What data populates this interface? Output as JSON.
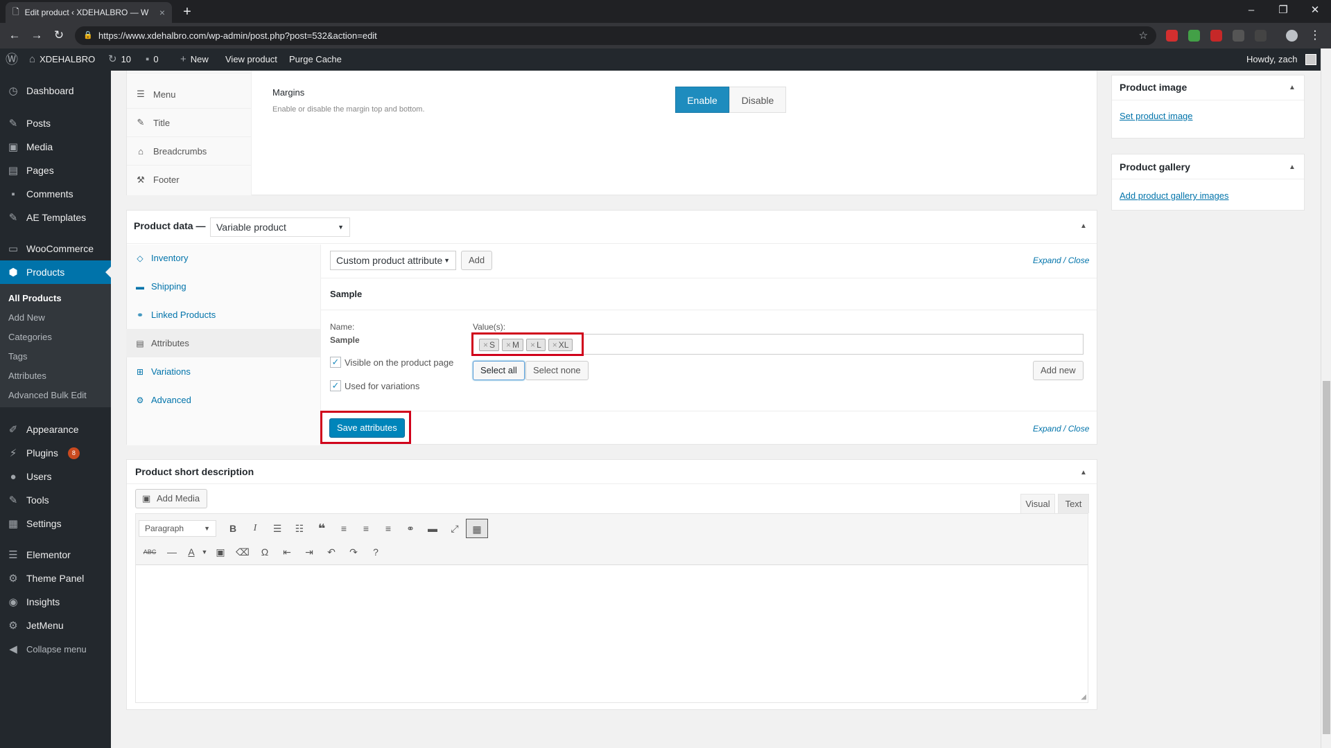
{
  "browser": {
    "tab_title": "Edit product ‹ XDEHALBRO — W",
    "url": "https://www.xdehalbro.com/wp-admin/post.php?post=532&action=edit"
  },
  "adminbar": {
    "site_name": "XDEHALBRO",
    "updates_count": "10",
    "comments_count": "0",
    "new_label": "New",
    "view_product": "View product",
    "purge_cache": "Purge Cache",
    "howdy": "Howdy, zach"
  },
  "sidebar": {
    "items": [
      {
        "label": "Dashboard",
        "icon": "dashboard-icon"
      },
      {
        "label": "Posts",
        "icon": "pin-icon"
      },
      {
        "label": "Media",
        "icon": "media-icon"
      },
      {
        "label": "Pages",
        "icon": "pages-icon"
      },
      {
        "label": "Comments",
        "icon": "comment-icon"
      },
      {
        "label": "AE Templates",
        "icon": "pin-icon"
      },
      {
        "label": "WooCommerce",
        "icon": "woo-icon"
      },
      {
        "label": "Products",
        "icon": "box-icon"
      },
      {
        "label": "Appearance",
        "icon": "brush-icon"
      },
      {
        "label": "Plugins",
        "icon": "plug-icon",
        "badge": "8"
      },
      {
        "label": "Users",
        "icon": "user-icon"
      },
      {
        "label": "Tools",
        "icon": "wrench-icon"
      },
      {
        "label": "Settings",
        "icon": "settings-icon"
      },
      {
        "label": "Elementor",
        "icon": "elementor-icon"
      },
      {
        "label": "Theme Panel",
        "icon": "gear-icon"
      },
      {
        "label": "Insights",
        "icon": "insights-icon"
      },
      {
        "label": "JetMenu",
        "icon": "gear-icon"
      },
      {
        "label": "Collapse menu",
        "icon": "collapse-icon"
      }
    ],
    "submenu": [
      "All Products",
      "Add New",
      "Categories",
      "Tags",
      "Attributes",
      "Advanced Bulk Edit"
    ]
  },
  "settings_box": {
    "tabs": [
      "Menu",
      "Title",
      "Breadcrumbs",
      "Footer"
    ],
    "margins_label": "Margins",
    "margins_desc": "Enable or disable the margin top and bottom.",
    "enable": "Enable",
    "disable": "Disable"
  },
  "product_data": {
    "title": "Product data —",
    "type": "Variable product",
    "tabs": [
      "Inventory",
      "Shipping",
      "Linked Products",
      "Attributes",
      "Variations",
      "Advanced"
    ],
    "attr_select": "Custom product attribute",
    "add_btn": "Add",
    "expand_close": "Expand / Close",
    "attr_title": "Sample",
    "name_label": "Name:",
    "name_value": "Sample",
    "values_label": "Value(s):",
    "values": [
      "S",
      "M",
      "L",
      "XL"
    ],
    "visible_label": "Visible on the product page",
    "variations_label": "Used for variations",
    "select_all": "Select all",
    "select_none": "Select none",
    "add_new": "Add new",
    "save_attributes": "Save attributes"
  },
  "short_desc": {
    "title": "Product short description",
    "add_media": "Add Media",
    "visual": "Visual",
    "text": "Text",
    "format": "Paragraph"
  },
  "right": {
    "image_title": "Product image",
    "set_image": "Set product image",
    "gallery_title": "Product gallery",
    "add_gallery": "Add product gallery images"
  }
}
